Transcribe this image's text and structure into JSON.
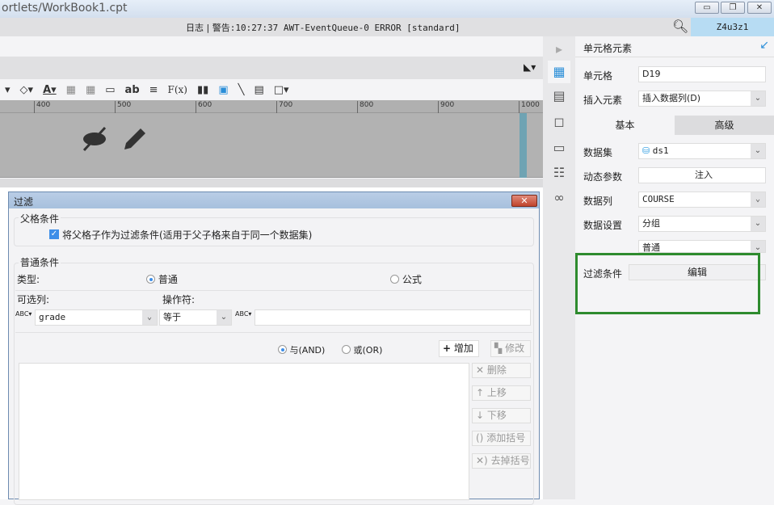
{
  "window": {
    "title": "ortlets/WorkBook1.cpt",
    "minimize": "▭",
    "restore": "❐",
    "close": "✕"
  },
  "logbar": {
    "log_label": "日志",
    "message": "警告:10:27:37 AWT-EventQueue-0 ERROR [standard]",
    "user": "Z4u3z1"
  },
  "toolbar": {
    "text_icon": "ab",
    "formula_icon": "F(x)"
  },
  "ruler": {
    "ticks": [
      "400",
      "500",
      "600",
      "700",
      "800",
      "900",
      "1000"
    ]
  },
  "panel": {
    "title": "单元格元素",
    "cell_label": "单元格",
    "cell_value": "D19",
    "insert_label": "插入元素",
    "insert_value": "插入数据列(D)",
    "tabs": [
      "基本",
      "高级"
    ],
    "dataset_label": "数据集",
    "dataset_value": "ds1",
    "param_label": "动态参数",
    "param_button": "注入",
    "column_label": "数据列",
    "column_value": "COURSE",
    "setting_label": "数据设置",
    "setting_value": "分组",
    "setting_value2": "普通",
    "filter_label": "过滤条件",
    "filter_button": "编辑",
    "highlight_color": "#2e8b2e"
  },
  "dialog": {
    "title": "过滤",
    "close": "✕",
    "parent_group": "父格条件",
    "parent_checkbox": "将父格子作为过滤条件(适用于父子格来自于同一个数据集)",
    "normal_group": "普通条件",
    "type_label": "类型:",
    "type_normal": "普通",
    "type_formula": "公式",
    "column_label": "可选列:",
    "operator_label": "操作符:",
    "column_value": "grade",
    "operator_value": "等于",
    "value": "",
    "and_label": "与(AND)",
    "or_label": "或(OR)",
    "add": "增加",
    "modify": "修改",
    "side_buttons": [
      "删除",
      "上移",
      "下移",
      "添加括号",
      "去掉括号"
    ]
  }
}
